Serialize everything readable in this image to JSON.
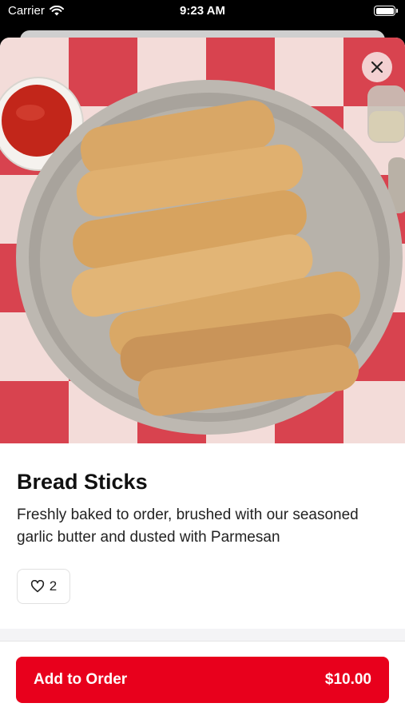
{
  "status_bar": {
    "carrier": "Carrier",
    "time": "9:23 AM"
  },
  "item": {
    "title": "Bread Sticks",
    "description": "Freshly baked to order, brushed with our seasoned garlic butter and dusted with Parmesan",
    "likes": "2"
  },
  "action": {
    "label": "Add to Order",
    "price": "$10.00"
  },
  "colors": {
    "accent": "#e8001c",
    "tablecloth": "#d8434f"
  },
  "icons": {
    "close": "close-icon",
    "heart": "heart-outline-icon",
    "wifi": "wifi-icon",
    "battery": "battery-icon"
  }
}
